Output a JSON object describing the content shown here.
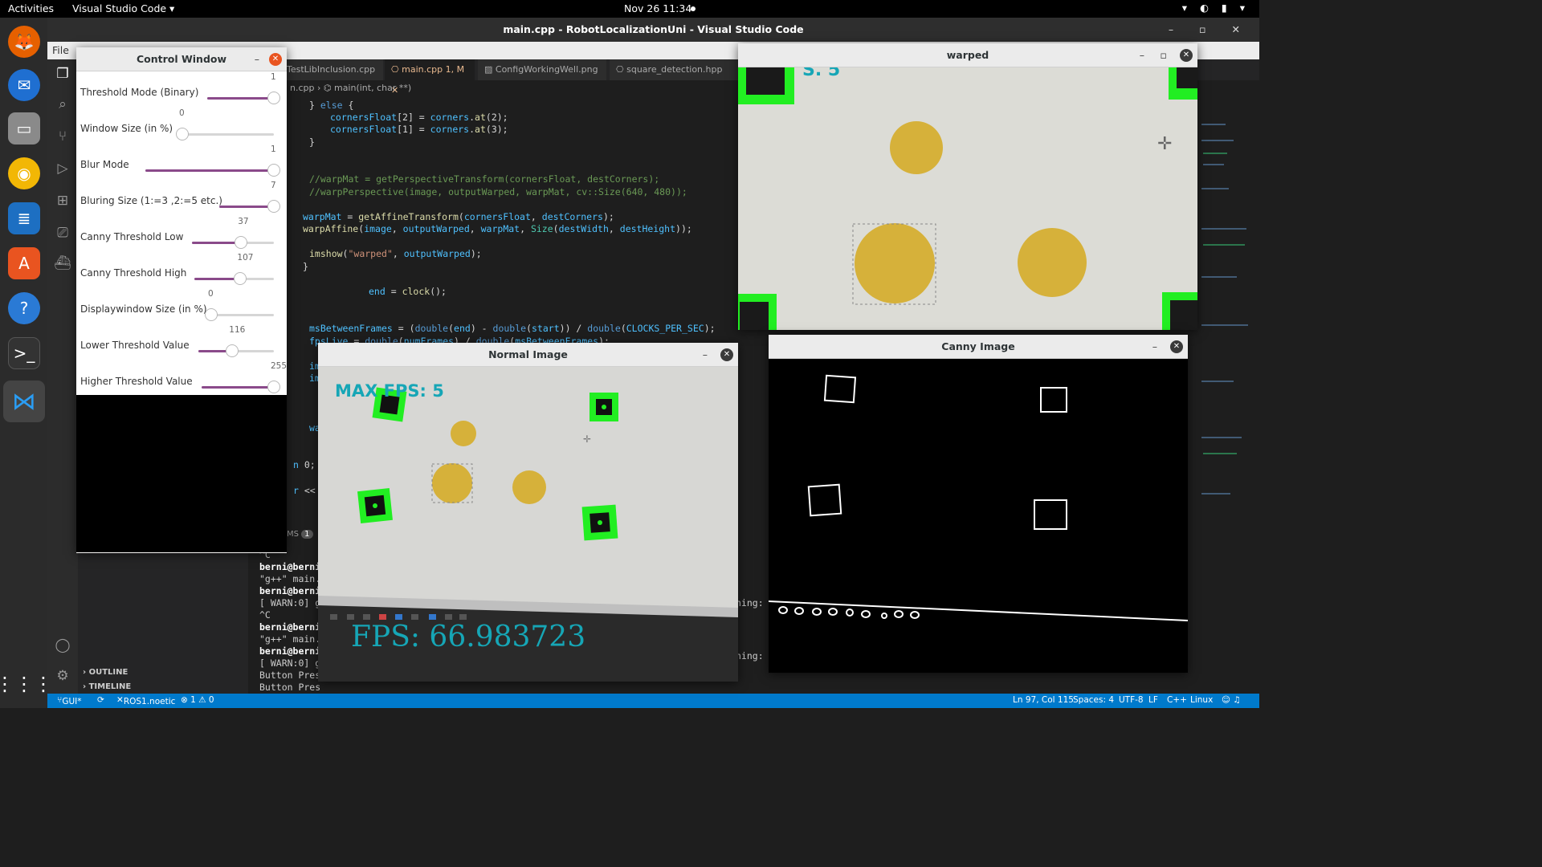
{
  "topbar": {
    "activities": "Activities",
    "app": "Visual Studio Code ▾",
    "clock": "Nov 26  11:34",
    "tray": "▾ ◐ ▮ ▾"
  },
  "dock": {
    "items": [
      "firefox-icon",
      "thunderbird-icon",
      "files-icon",
      "rhythmbox-icon",
      "writer-icon",
      "software-icon",
      "help-icon",
      "terminal-icon",
      "vscode-icon",
      "apps-grid-icon"
    ]
  },
  "vscode": {
    "title": "main.cpp - RobotLocalizationUni - Visual Studio Code",
    "window_controls": "– ▫ ✕",
    "menu_file": "File",
    "tabs": [
      {
        "label": "TestLibInclusion.cpp"
      },
      {
        "label": "main.cpp 1, M"
      },
      {
        "label": "ConfigWorkingWell.png"
      },
      {
        "label": "square_detection.hpp"
      }
    ],
    "breadcrumb": "n.cpp  ›  ⌬ main(int, char **)",
    "outline": "OUTLINE",
    "timeline": "TIMELINE",
    "problems_label": "MS",
    "problems_count": "1",
    "terminal": [
      "^C",
      "berni@berni",
      "\"g++\" main.",
      "berni@berni",
      "[ WARN:0] g",
      "^C",
      "berni@berni",
      "\"g++\" main.",
      "berni@berni",
      "[ WARN:0] g",
      "Button Pres",
      "Button Pres"
    ],
    "term_right_1": "ning:",
    "term_right_2": "ning:",
    "status": {
      "branch": "GUI*",
      "ros": "ROS1.noetic",
      "problems": "⊗ 1 ⚠ 0",
      "position": "Ln 97, Col 115",
      "spaces": "Spaces: 4",
      "encoding": "UTF-8",
      "eol": "LF",
      "lang": "C++",
      "os": "Linux"
    }
  },
  "control_window": {
    "title": "Control Window",
    "sliders": [
      {
        "label": "Threshold Mode (Binary)",
        "value": "1",
        "fraction": 1.0
      },
      {
        "label": "Window Size (in %)",
        "value": "0",
        "fraction": 0.0
      },
      {
        "label": "Blur Mode",
        "value": "1",
        "fraction": 1.0
      },
      {
        "label": "Bluring Size (1:=3 ,2:=5 etc.)",
        "value": "7",
        "fraction": 1.0
      },
      {
        "label": "Canny Threshold Low",
        "value": "37",
        "fraction": 0.6
      },
      {
        "label": "Canny Threshold High",
        "value": "107",
        "fraction": 0.58
      },
      {
        "label": "Displaywindow Size (in %)",
        "value": "0",
        "fraction": 0.0
      },
      {
        "label": "Lower Threshold Value",
        "value": "116",
        "fraction": 0.45
      },
      {
        "label": "Higher Threshold Value",
        "value": "255",
        "fraction": 1.0
      }
    ]
  },
  "warped_window": {
    "title": "warped"
  },
  "normal_window": {
    "title": "Normal Image",
    "max_fps": "MAX FPS: 5",
    "fps": "FPS: 66.983723"
  },
  "canny_window": {
    "title": "Canny Image"
  },
  "colors": {
    "accent": "#007acc",
    "slider": "#8a4a8a",
    "marker": "#22ee22",
    "dot": "#d6b13a",
    "cyan": "#16a6b6"
  }
}
